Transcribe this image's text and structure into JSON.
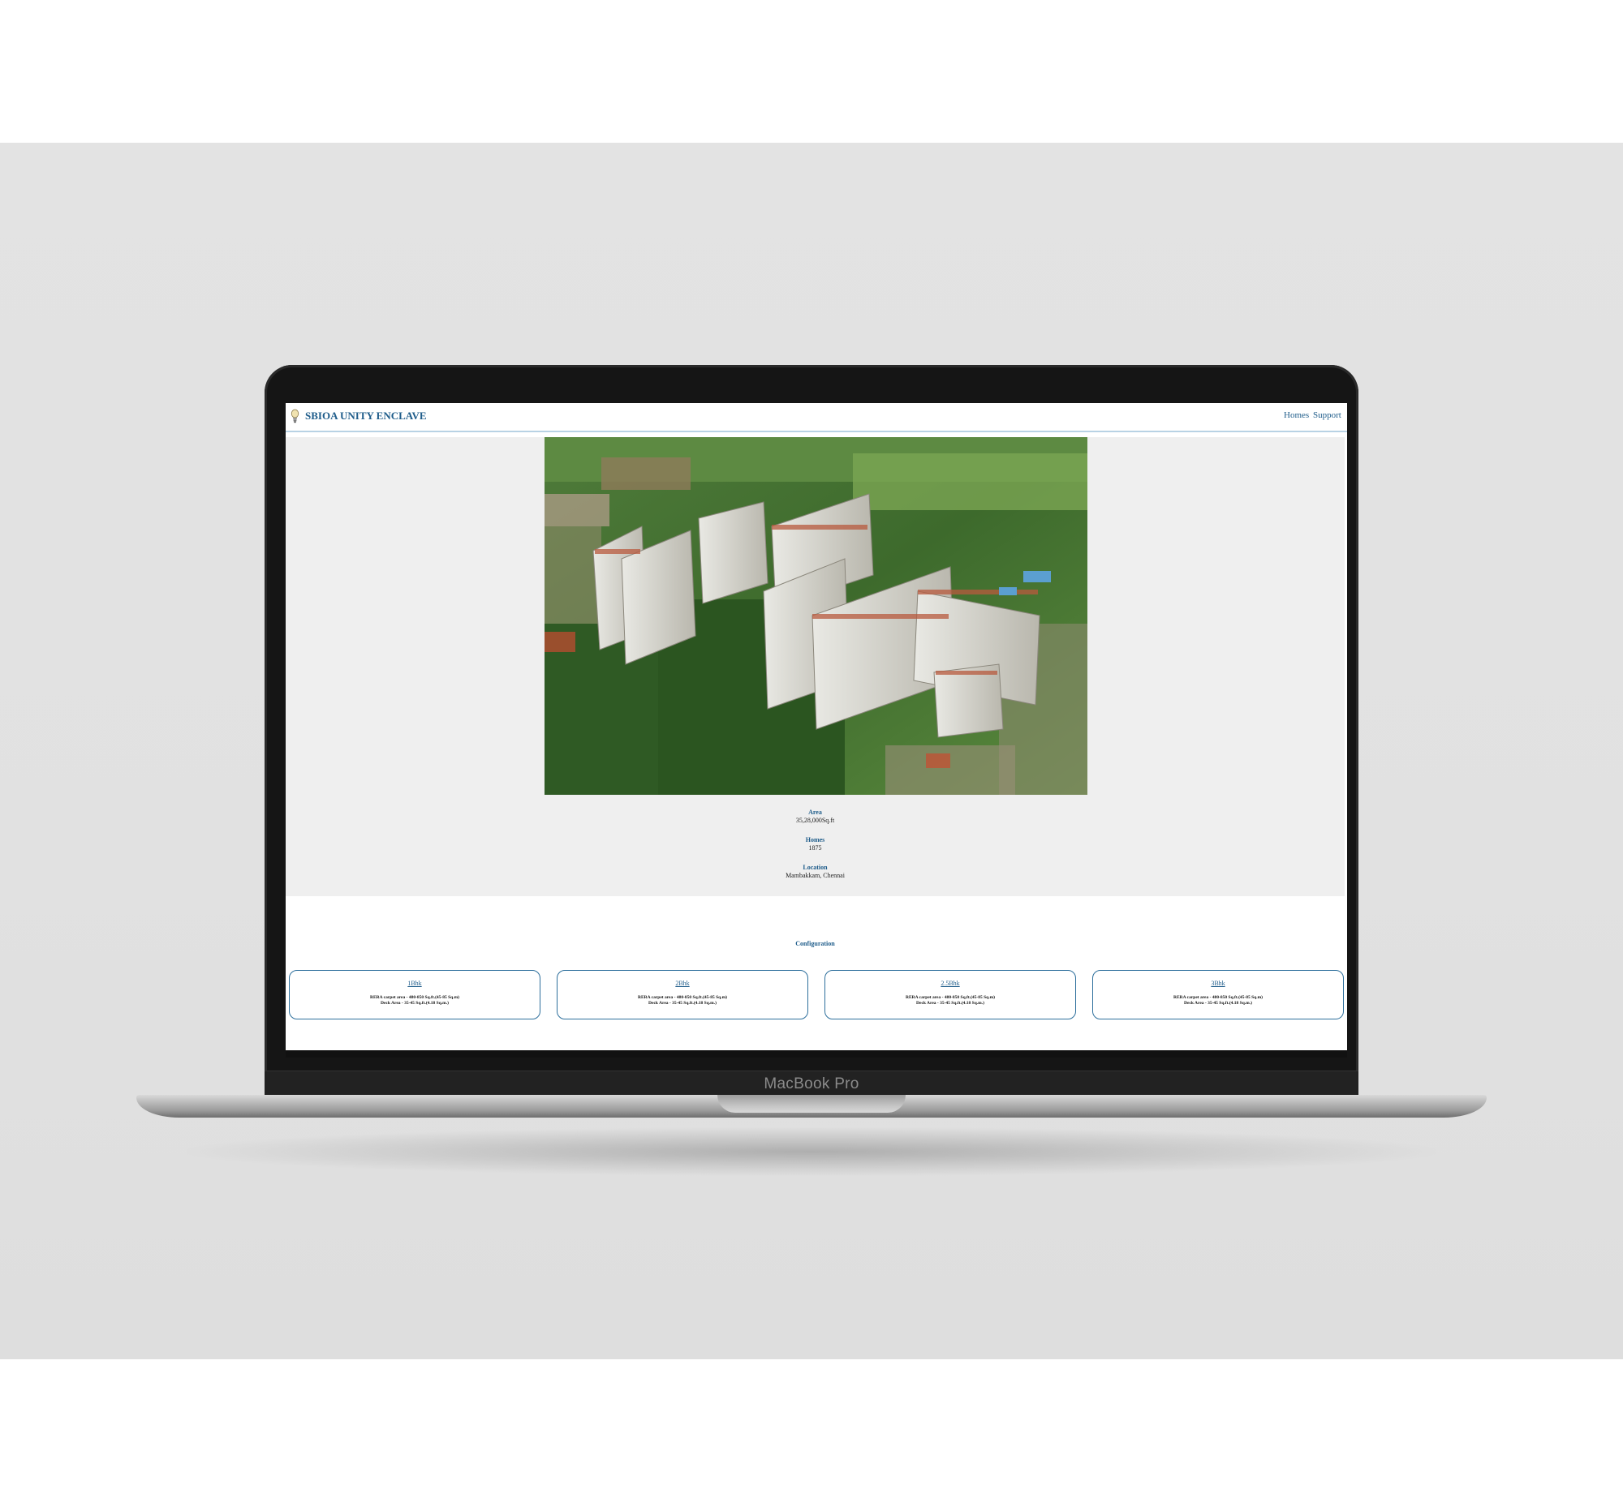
{
  "laptop": {
    "model_label": "MacBook Pro"
  },
  "navbar": {
    "brand": "SBIOA UNITY ENCLAVE",
    "icon": "lightbulb-icon",
    "links": [
      "Homes",
      "Support"
    ]
  },
  "hero": {
    "stats": [
      {
        "label": "Area",
        "value": "35,28,000Sq.ft"
      },
      {
        "label": "Homes",
        "value": "1875"
      },
      {
        "label": "Location",
        "value": "Mambakkam, Chennai"
      }
    ]
  },
  "configuration": {
    "title": "Configuration",
    "cards": [
      {
        "title": "1Bhk",
        "line1": "RERA carpet area - 480-850 Sq.ft.(45-85 Sq.m)",
        "line2": "Deck Area - 35-45 Sq.ft.(4.18 Sq.m.)"
      },
      {
        "title": "2Bhk",
        "line1": "RERA carpet area - 480-850 Sq.ft.(45-85 Sq.m)",
        "line2": "Deck Area - 35-45 Sq.ft.(4.18 Sq.m.)"
      },
      {
        "title": "2.5Bhk",
        "line1": "RERA carpet area - 480-850 Sq.ft.(45-85 Sq.m)",
        "line2": "Deck Area - 35-45 Sq.ft.(4.18 Sq.m.)"
      },
      {
        "title": "3Bhk",
        "line1": "RERA carpet area - 480-850 Sq.ft.(45-85 Sq.m)",
        "line2": "Deck Area - 35-45 Sq.ft.(4.18 Sq.m.)"
      }
    ]
  },
  "colors": {
    "accent": "#1e5c8a",
    "hero_bg": "#efefef",
    "card_border": "#2d6f9c"
  }
}
